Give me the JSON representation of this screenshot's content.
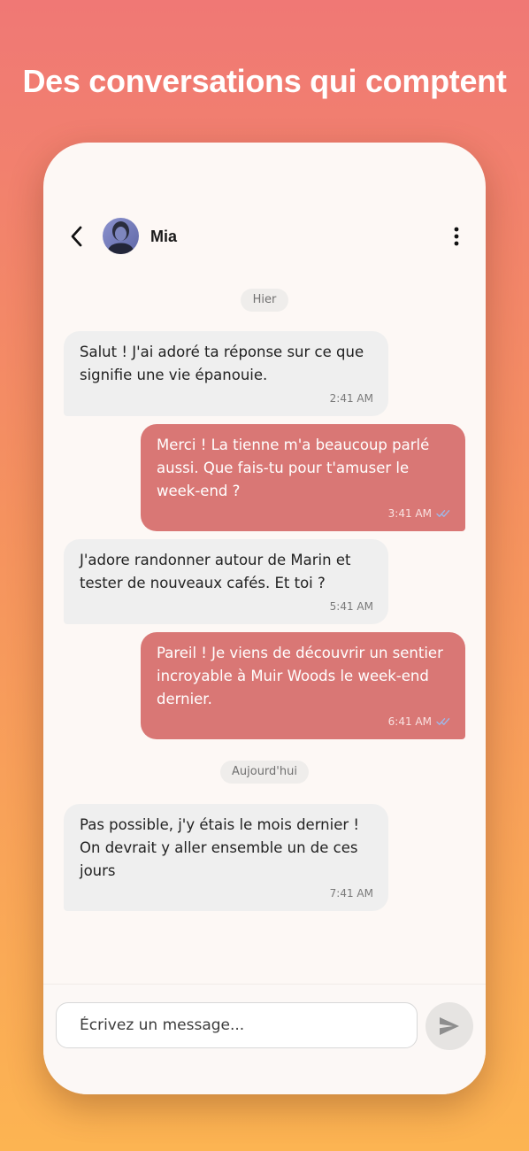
{
  "headline": "Des conversations qui comptent",
  "header": {
    "contact_name": "Mia"
  },
  "chat": {
    "dates": [
      "Hier",
      "Aujourd'hui"
    ],
    "messages": [
      {
        "direction": "in",
        "text": "Salut ! J'ai adoré ta réponse sur ce que signifie une vie épanouie.",
        "time": "2:41 AM"
      },
      {
        "direction": "out",
        "text": "Merci ! La tienne m'a beaucoup parlé aussi. Que fais-tu pour t'amuser le week-end ?",
        "time": "3:41 AM",
        "status": "read"
      },
      {
        "direction": "in",
        "text": "J'adore randonner autour de Marin et tester de nouveaux cafés. Et toi ?",
        "time": "5:41 AM"
      },
      {
        "direction": "out",
        "text": "Pareil ! Je viens de découvrir un sentier incroyable à Muir Woods le week-end dernier.",
        "time": "6:41 AM",
        "status": "read"
      },
      {
        "direction": "in",
        "text": "Pas possible, j'y étais le mois dernier ! On devrait y aller ensemble un de ces jours",
        "time": "7:41 AM"
      }
    ]
  },
  "composer": {
    "placeholder": "Écrivez un message..."
  },
  "colors": {
    "gradient_top": "#F07875",
    "gradient_bottom": "#FCB452",
    "outgoing_bubble": "#D97775",
    "incoming_bubble": "#EFEFEF",
    "read_check": "#9FB8E8"
  },
  "icons": {
    "back": "chevron-left-icon",
    "menu": "more-vertical-icon",
    "read_status": "double-check-icon",
    "send": "send-icon"
  }
}
